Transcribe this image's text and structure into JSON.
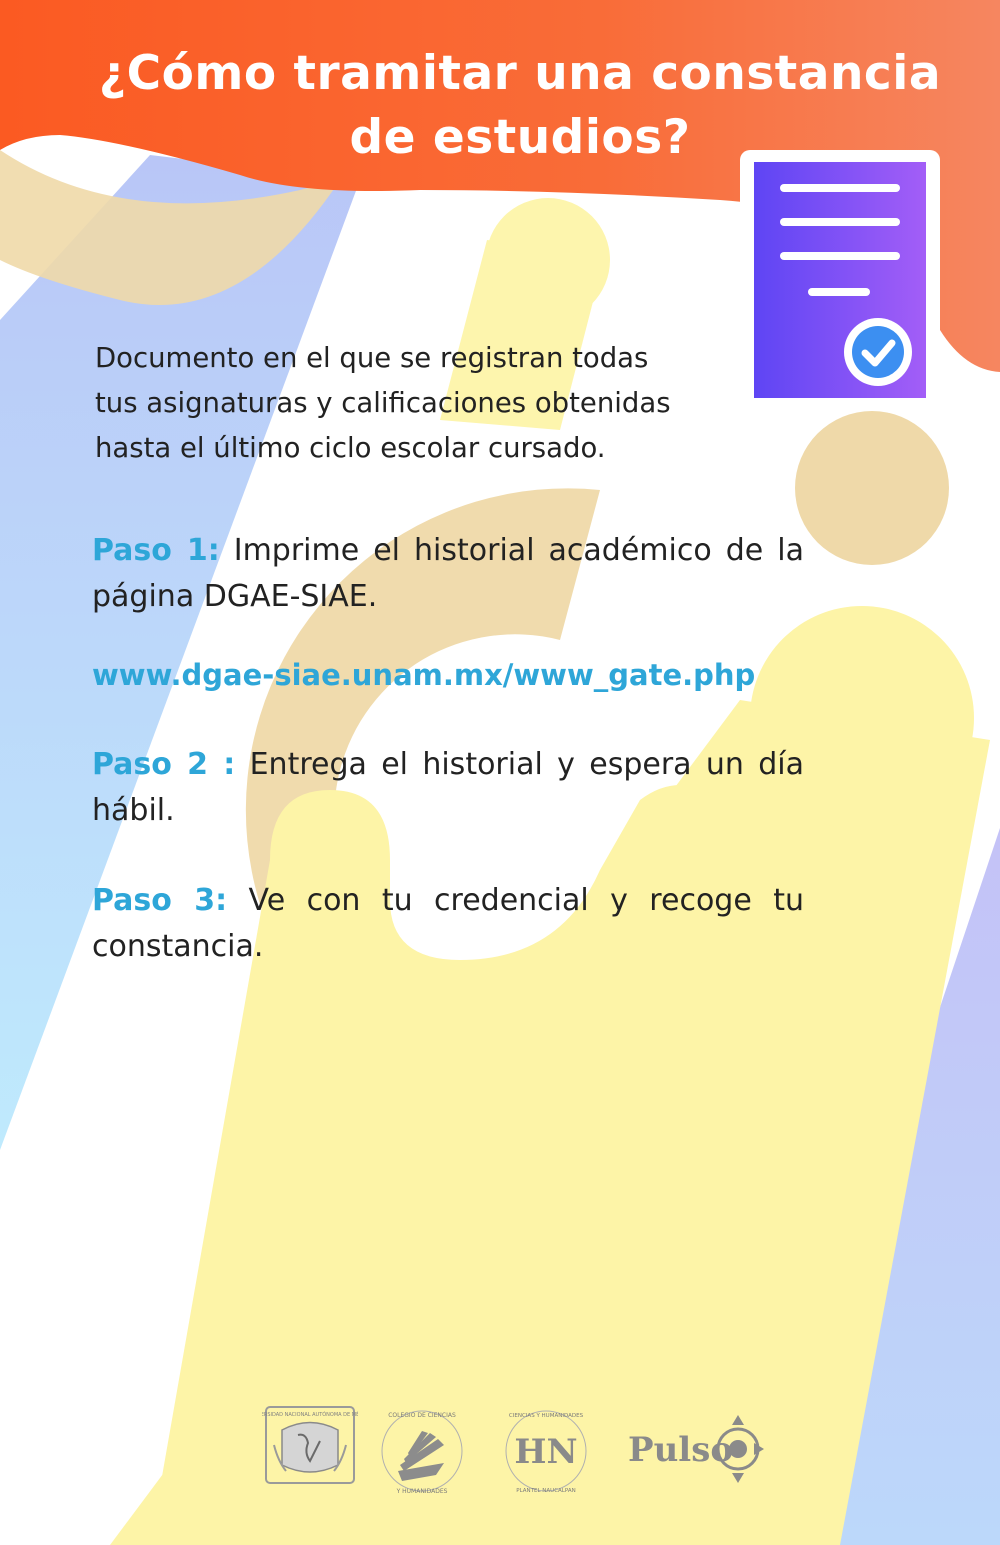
{
  "header": {
    "title_line1": "¿Cómo tramitar una constancia",
    "title_line2": "de estudios?",
    "banner_color": "#f9612a"
  },
  "document_icon": {
    "name": "document-check-icon",
    "gradient": [
      "#6a4cf5",
      "#9b5cf6"
    ],
    "check_color": "#3b8ff0"
  },
  "intro": {
    "line1": "Documento en el que se registran todas",
    "line2": "tus asignaturas y calificaciones obtenidas",
    "line3": "hasta el último ciclo escolar cursado."
  },
  "steps": [
    {
      "label": "Paso 1:",
      "text": "Imprime el historial académico de la página DGAE-SIAE."
    },
    {
      "label": "Paso 2 :",
      "text": "Entrega el historial y espera un día hábil."
    },
    {
      "label": "Paso 3:",
      "text": "Ve con tu credencial y recoge tu constancia."
    }
  ],
  "link": {
    "url": "www.dgae-siae.unam.mx/www_gate.php"
  },
  "accent_color": "#2ea6d8",
  "logos": {
    "unam_text": "UNIVERSIDAD NACIONAL AUTÓNOMA DE MÉXICO",
    "cch_text": "COLEGIO DE CIENCIAS Y HUMANIDADES",
    "cch_naucalpan_text": "COLEGIO DE CIENCIAS Y HUMANIDADES · PLANTEL NAUCALPAN ·",
    "pulso_text": "Pulso"
  }
}
